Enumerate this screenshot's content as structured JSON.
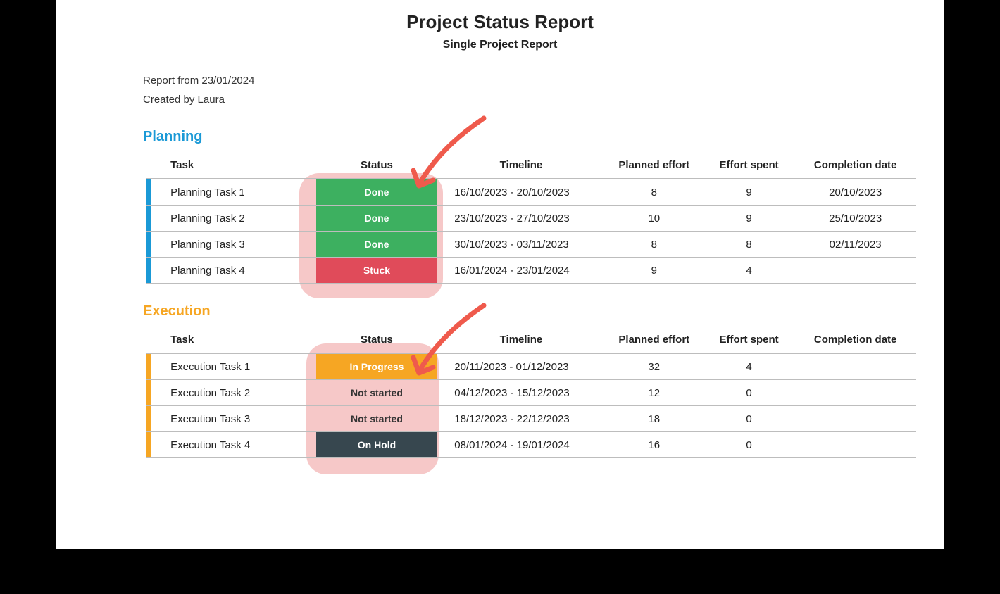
{
  "header": {
    "title": "Project Status Report",
    "subtitle": "Single Project Report"
  },
  "meta": {
    "report_from_label": "Report from",
    "report_date": "23/01/2024",
    "created_by_label": "Created by",
    "created_by": "Laura"
  },
  "columns": {
    "task": "Task",
    "status": "Status",
    "timeline": "Timeline",
    "planned_effort": "Planned effort",
    "effort_spent": "Effort spent",
    "completion_date": "Completion date"
  },
  "sections": [
    {
      "title": "Planning",
      "accent": "#1a99d6",
      "marker_class": "blue",
      "rows": [
        {
          "task": "Planning Task 1",
          "status": "Done",
          "status_class": "Done",
          "timeline": "16/10/2023 - 20/10/2023",
          "planned": "8",
          "spent": "9",
          "completion": "20/10/2023"
        },
        {
          "task": "Planning Task 2",
          "status": "Done",
          "status_class": "Done",
          "timeline": "23/10/2023 - 27/10/2023",
          "planned": "10",
          "spent": "9",
          "completion": "25/10/2023"
        },
        {
          "task": "Planning Task 3",
          "status": "Done",
          "status_class": "Done",
          "timeline": "30/10/2023 - 03/11/2023",
          "planned": "8",
          "spent": "8",
          "completion": "02/11/2023"
        },
        {
          "task": "Planning Task 4",
          "status": "Stuck",
          "status_class": "Stuck",
          "timeline": "16/01/2024 - 23/01/2024",
          "planned": "9",
          "spent": "4",
          "completion": ""
        }
      ]
    },
    {
      "title": "Execution",
      "accent": "#f6a623",
      "marker_class": "orange",
      "rows": [
        {
          "task": "Execution Task 1",
          "status": "In Progress",
          "status_class": "InProgress",
          "timeline": "20/11/2023 - 01/12/2023",
          "planned": "32",
          "spent": "4",
          "completion": ""
        },
        {
          "task": "Execution Task 2",
          "status": "Not started",
          "status_class": "NotStarted",
          "timeline": "04/12/2023 - 15/12/2023",
          "planned": "12",
          "spent": "0",
          "completion": ""
        },
        {
          "task": "Execution Task 3",
          "status": "Not started",
          "status_class": "NotStarted",
          "timeline": "18/12/2023 - 22/12/2023",
          "planned": "18",
          "spent": "0",
          "completion": ""
        },
        {
          "task": "Execution Task 4",
          "status": "On Hold",
          "status_class": "OnHold",
          "timeline": "08/01/2024 - 19/01/2024",
          "planned": "16",
          "spent": "0",
          "completion": ""
        }
      ]
    }
  ],
  "annotations": {
    "highlight_color": "#f4b4b0"
  }
}
